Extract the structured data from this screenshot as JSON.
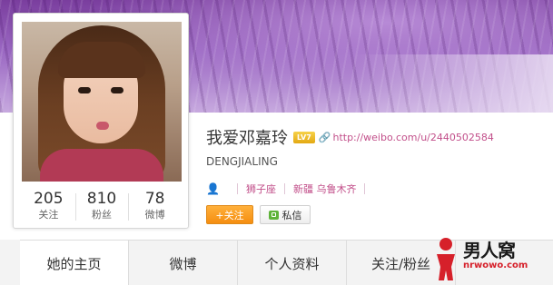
{
  "profile": {
    "name": "我爱邓嘉玲",
    "level_badge": "LV7",
    "url": "http://weibo.com/u/2440502584",
    "pinyin_name": "DENGJIALING",
    "zodiac": "狮子座",
    "location": "新疆 乌鲁木齐"
  },
  "stats": [
    {
      "num": "205",
      "label": "关注"
    },
    {
      "num": "810",
      "label": "粉丝"
    },
    {
      "num": "78",
      "label": "微博"
    }
  ],
  "actions": {
    "follow_label": "+关注",
    "message_label": "私信"
  },
  "tabs": [
    {
      "label": "她的主页",
      "active": true
    },
    {
      "label": "微博",
      "active": false
    },
    {
      "label": "个人资料",
      "active": false
    },
    {
      "label": "关注/粉丝",
      "active": false
    }
  ],
  "watermark": {
    "cn": "男人窝",
    "en": "nrwowo.com"
  },
  "colors": {
    "accent_pink": "#c24f8a",
    "follow_orange": "#f58e10",
    "message_green": "#5fb33a"
  }
}
